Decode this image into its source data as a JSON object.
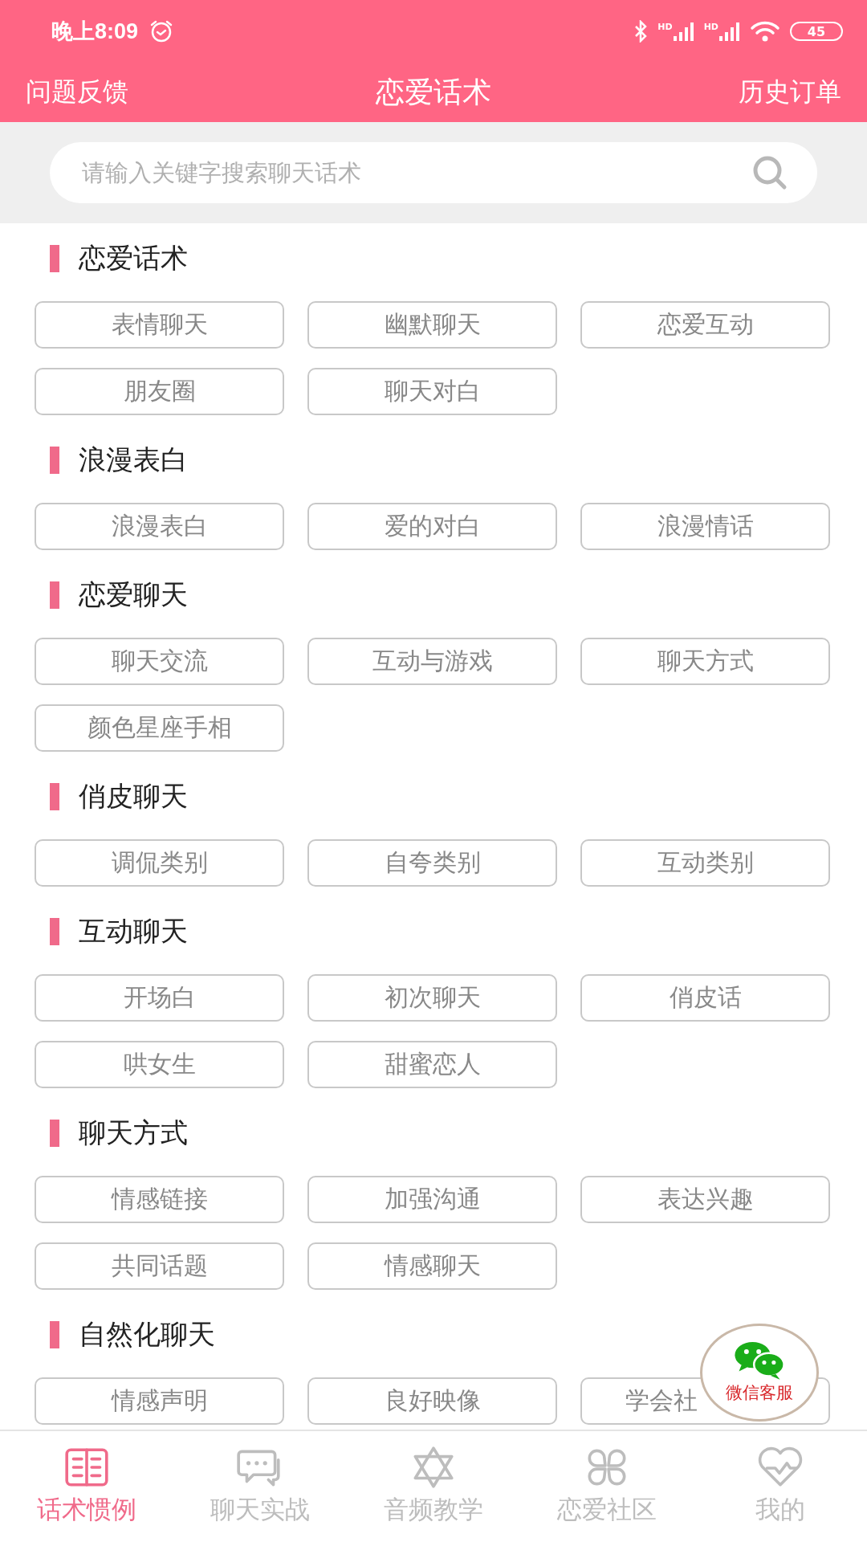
{
  "status_bar": {
    "time": "晚上8:09",
    "signals": [
      {
        "label": "HD"
      },
      {
        "label": "HD"
      }
    ],
    "battery": "45"
  },
  "header": {
    "left": "问题反馈",
    "title": "恋爱话术",
    "right": "历史订单"
  },
  "search": {
    "placeholder": "请输入关键字搜索聊天话术"
  },
  "sections": [
    {
      "title": "恋爱话术",
      "tags": [
        "表情聊天",
        "幽默聊天",
        "恋爱互动",
        "朋友圈",
        "聊天对白"
      ]
    },
    {
      "title": "浪漫表白",
      "tags": [
        "浪漫表白",
        "爱的对白",
        "浪漫情话"
      ]
    },
    {
      "title": "恋爱聊天",
      "tags": [
        "聊天交流",
        "互动与游戏",
        "聊天方式",
        "颜色星座手相"
      ]
    },
    {
      "title": "俏皮聊天",
      "tags": [
        "调侃类别",
        "自夸类别",
        "互动类别"
      ]
    },
    {
      "title": "互动聊天",
      "tags": [
        "开场白",
        "初次聊天",
        "俏皮话",
        "哄女生",
        "甜蜜恋人"
      ]
    },
    {
      "title": "聊天方式",
      "tags": [
        "情感链接",
        "加强沟通",
        "表达兴趣",
        "共同话题",
        "情感聊天"
      ]
    },
    {
      "title": "自然化聊天",
      "tags": [
        "情感声明",
        "良好映像",
        {
          "label": "学会社",
          "cut": true
        }
      ]
    }
  ],
  "float_button": {
    "label": "微信客服"
  },
  "tabs": [
    {
      "label": "话术惯例",
      "selected": true
    },
    {
      "label": "聊天实战",
      "selected": false
    },
    {
      "label": "音频教学",
      "selected": false
    },
    {
      "label": "恋爱社区",
      "selected": false
    },
    {
      "label": "我的",
      "selected": false
    }
  ]
}
